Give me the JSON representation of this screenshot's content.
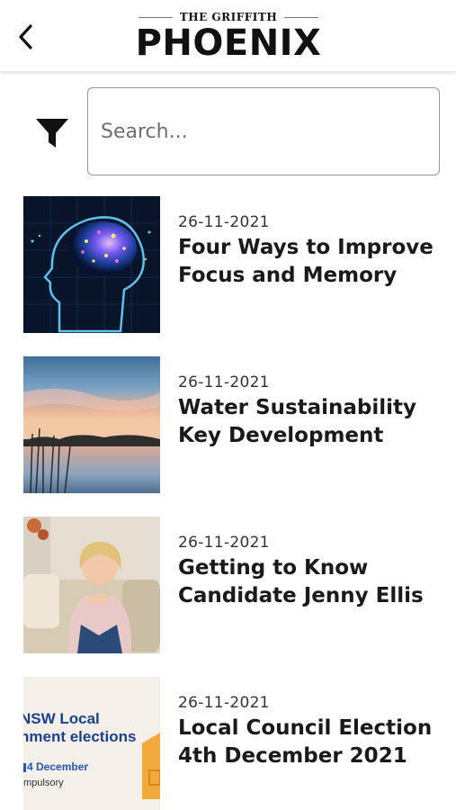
{
  "header": {
    "logo_top": "THE GRIFFITH",
    "logo_main": "PHOENIX",
    "back_icon": "chevron-left-icon"
  },
  "search": {
    "placeholder": "Search...",
    "value": "",
    "filter_icon": "filter-icon"
  },
  "articles": [
    {
      "date": "26-11-2021",
      "title": "Four Ways to Improve Focus and Memory",
      "image": "brain-illustration"
    },
    {
      "date": "26-11-2021",
      "title": "Water Sustainability Key Development",
      "image": "lake-sunset"
    },
    {
      "date": "26-11-2021",
      "title": "Getting to Know Candidate Jenny Ellis",
      "image": "candidate-portrait"
    },
    {
      "date": "26-11-2021",
      "title": "Local Council Election 4th December 2021",
      "image": "election-banner",
      "image_text": {
        "line1": "NSW Local",
        "line2": "nment elections",
        "line3": "4 December",
        "line4": "mpulsory"
      }
    }
  ]
}
